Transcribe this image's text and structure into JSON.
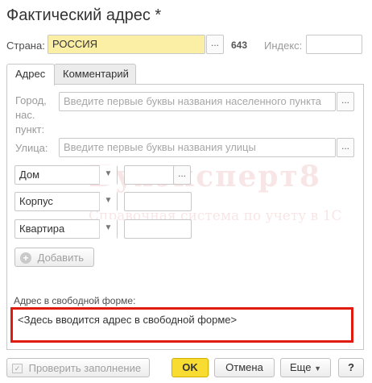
{
  "form": {
    "title": "Фактический адрес *"
  },
  "country": {
    "label": "Страна:",
    "value": "РОССИЯ",
    "select_button": "...",
    "code": "643"
  },
  "index": {
    "label": "Индекс:",
    "value": ""
  },
  "tabs": [
    {
      "label": "Адрес",
      "active": true
    },
    {
      "label": "Комментарий",
      "active": false
    }
  ],
  "address": {
    "city": {
      "label": "Город, нас. пункт:",
      "placeholder": "Введите первые буквы названия населенного пункта",
      "select_button": "..."
    },
    "street": {
      "label": "Улица:",
      "placeholder": "Введите первые буквы названия улицы",
      "select_button": "..."
    },
    "house": {
      "type": "Дом",
      "select_button": "..."
    },
    "building": {
      "type": "Корпус"
    },
    "apartment": {
      "type": "Квартира"
    },
    "add_button": "Добавить"
  },
  "watermark": {
    "line1": "Бухэксперт8",
    "line2": "Справочная система по учету в 1С"
  },
  "freeform": {
    "label": "Адрес в свободной форме:",
    "value": "<Здесь вводится адрес в свободной форме>"
  },
  "footer": {
    "check_button": "Проверить заполнение",
    "ok_button": "OK",
    "cancel_button": "Отмена",
    "more_button": "Еще",
    "help_button": "?"
  },
  "colors": {
    "ok_yellow": "#f9dc32",
    "country_field": "#fbeea5",
    "highlight_red": "#e01b0d"
  }
}
